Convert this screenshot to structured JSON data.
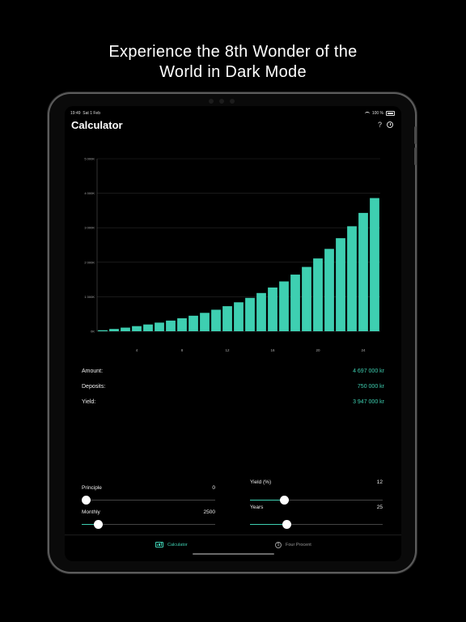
{
  "headline": {
    "line1": "Experience the 8th Wonder of the",
    "line2": "World in Dark Mode"
  },
  "status": {
    "time": "19:49",
    "date": "Sat 1 Feb",
    "battery": "100 %"
  },
  "header": {
    "title": "Calculator",
    "help": "?"
  },
  "colors": {
    "accent": "#3ecfb1",
    "background": "#000000"
  },
  "chart_data": {
    "type": "bar",
    "x": [
      1,
      2,
      3,
      4,
      5,
      6,
      7,
      8,
      9,
      10,
      11,
      12,
      13,
      14,
      15,
      16,
      17,
      18,
      19,
      20,
      21,
      22,
      23,
      24,
      25
    ],
    "values": [
      30,
      66,
      105,
      148,
      196,
      250,
      309,
      376,
      450,
      533,
      624,
      726,
      839,
      967,
      1108,
      1267,
      1444,
      1642,
      1864,
      2110,
      2387,
      2697,
      3043,
      3430,
      3860
    ],
    "ytick_values": [
      0,
      1000,
      2000,
      3000,
      4000,
      5000
    ],
    "ytick_labels": [
      "0K",
      "1 000K",
      "2 000K",
      "3 000K",
      "4 000K",
      "5 000K"
    ],
    "xtick_values": [
      4,
      8,
      12,
      16,
      20,
      24
    ],
    "xtick_labels": [
      "4",
      "8",
      "12",
      "16",
      "20",
      "24"
    ],
    "ylim": [
      0,
      5000
    ],
    "grid": true
  },
  "summary": [
    {
      "label": "Amount:",
      "value": "4 697 000 kr"
    },
    {
      "label": "Deposits:",
      "value": "750 000 kr"
    },
    {
      "label": "Yield:",
      "value": "3 947 000 kr"
    }
  ],
  "controls": {
    "principle": {
      "label": "Principle",
      "value": "0",
      "level": 0.0
    },
    "monthly": {
      "label": "Monthly",
      "value": "2500",
      "level": 0.1
    },
    "yield": {
      "label": "Yield (%)",
      "value": "12",
      "level": 0.24
    },
    "years": {
      "label": "Years",
      "value": "25",
      "level": 0.26
    }
  },
  "tabs": [
    {
      "label": "Calculator",
      "coin": "$"
    },
    {
      "label": "Four Procent",
      "coin": "$"
    }
  ]
}
